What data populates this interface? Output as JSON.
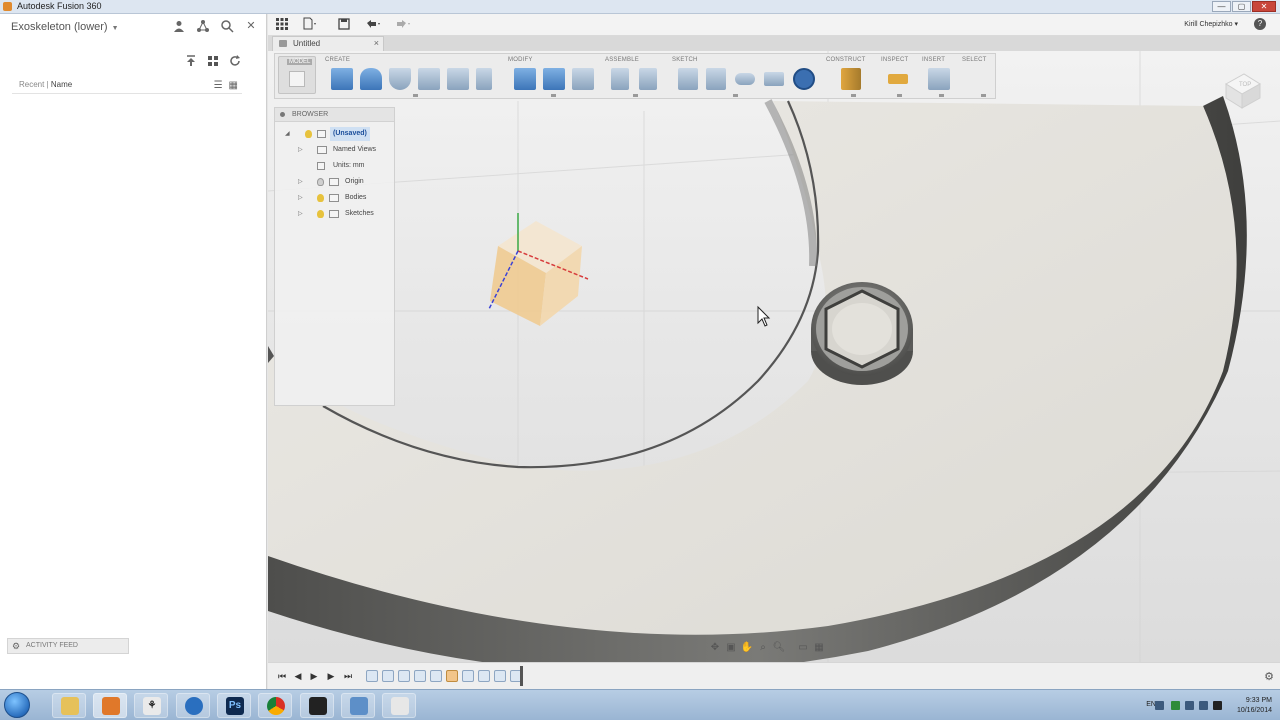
{
  "window": {
    "title": "Autodesk Fusion 360",
    "min_label": "—",
    "max_label": "▢",
    "close_label": "✕"
  },
  "data_panel": {
    "project_name": "Exoskeleton (lower)",
    "list_header_recent": "Recent",
    "list_header_sep": " | ",
    "list_header_name": "Name",
    "activity_feed": "ACTIVITY FEED"
  },
  "quickbar": {
    "user_name": "Kirill Chepizhko",
    "help_label": "?"
  },
  "tab": {
    "title": "Untitled",
    "close_label": "×"
  },
  "toolbar": {
    "model_label": "MODEL",
    "sections": {
      "create": "CREATE",
      "modify": "MODIFY",
      "assemble": "ASSEMBLE",
      "sketch": "SKETCH",
      "construct": "CONSTRUCT",
      "inspect": "INSPECT",
      "insert": "INSERT",
      "select": "SELECT"
    }
  },
  "browser": {
    "header": "BROWSER",
    "root": "(Unsaved)",
    "items": [
      "Named Views",
      "Units: mm",
      "Origin",
      "Bodies",
      "Sketches"
    ]
  },
  "viewcube": {
    "face_label": "TOP"
  },
  "taskbar": {
    "language": "EN",
    "time": "9:33 PM",
    "date": "10/16/2014"
  },
  "colors": {
    "accent": "#3b6fb1",
    "ring_dark": "#5a5a58",
    "ring_face": "#e4e2dc",
    "origin_plane": "#f0c98c"
  }
}
